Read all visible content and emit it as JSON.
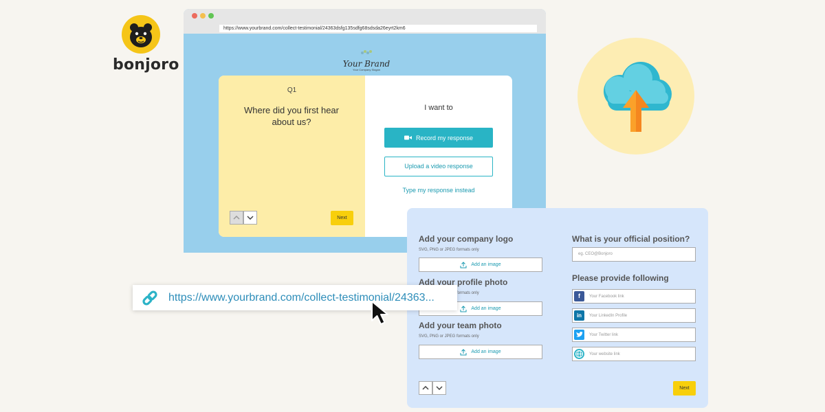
{
  "brand_logo": {
    "name": "bonjoro",
    "icon": "bear-icon"
  },
  "browser": {
    "url": "https://www.yourbrand.com/collect-testimonial/24363dsfg135sdfg68sdsda26eyrt2km6",
    "brand_name": "Your Brand",
    "brand_tagline": "Your Company Slogan",
    "question": {
      "label": "Q1",
      "text": "Where did you first hear about us?",
      "next_label": "Next"
    },
    "response": {
      "heading": "I want to",
      "record_label": "Record my response",
      "upload_label": "Upload a video response",
      "type_label": "Type my response instead"
    }
  },
  "upload_graphic": {
    "icon": "cloud-upload-icon"
  },
  "form": {
    "company_logo": {
      "heading": "Add your company logo",
      "hint": "SVG, PNG or JPEG formats only",
      "button": "Add an image"
    },
    "profile_photo": {
      "heading": "Add your profile photo",
      "hint": "SVG, PNG or JPEG formats only",
      "button": "Add an image"
    },
    "team_photo": {
      "heading": "Add your team photo",
      "hint": "SVG, PNG or JPEG formats only",
      "button": "Add an image"
    },
    "position": {
      "heading": "What is your official position?",
      "placeholder": "eg. CEO@Bonjoro"
    },
    "links": {
      "heading": "Please provide following",
      "facebook": "Your Facebook link",
      "linkedin": "Your LinkedIn Profile",
      "twitter": "Your Twitter link",
      "website": "Your website link"
    },
    "next_label": "Next"
  },
  "share_link": {
    "text": "https://www.yourbrand.com/collect-testimonial/24363..."
  },
  "colors": {
    "accent": "#29b4c5",
    "yellow": "#f8cf0b",
    "browser_bg": "#98cfec",
    "form_bg": "#d6e6fb"
  }
}
